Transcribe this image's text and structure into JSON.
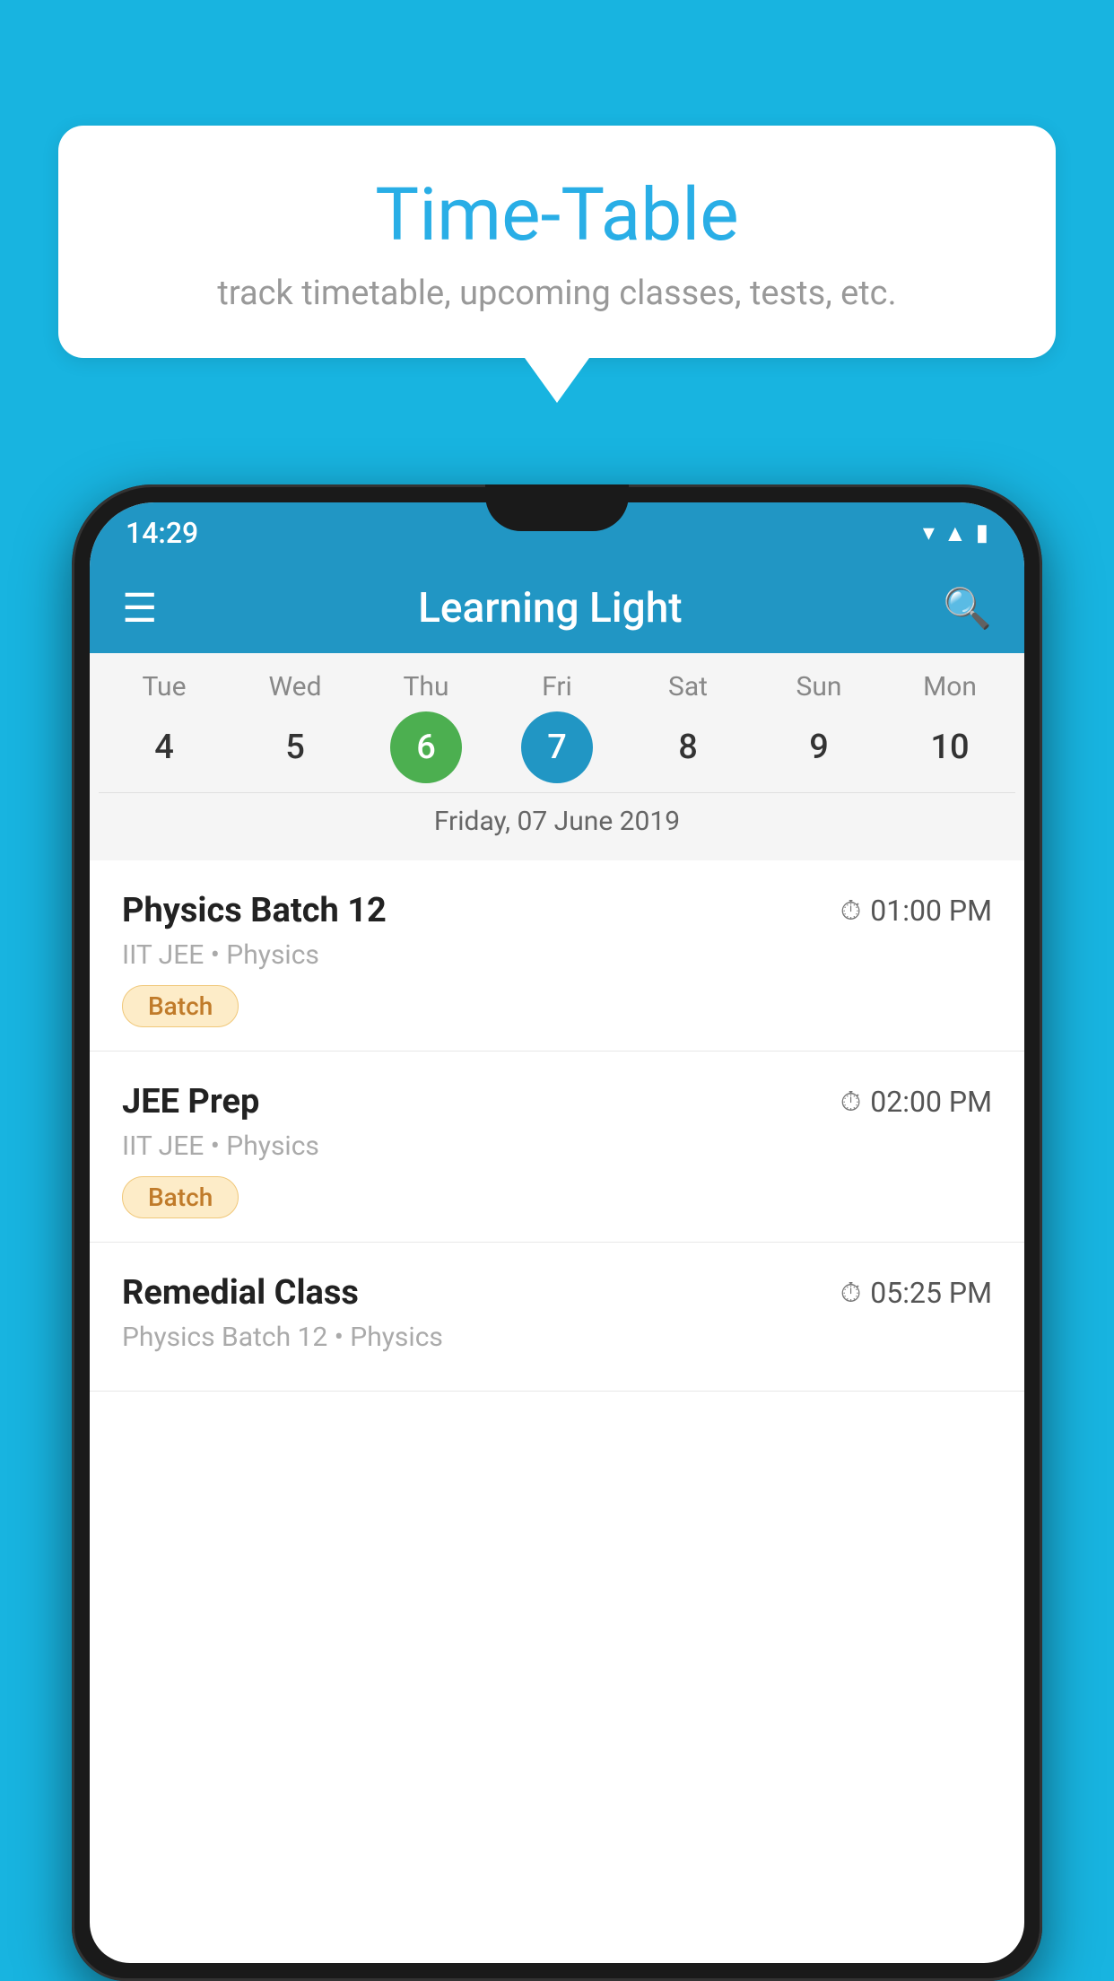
{
  "background_color": "#18b4e0",
  "speech_bubble": {
    "title": "Time-Table",
    "subtitle": "track timetable, upcoming classes, tests, etc."
  },
  "status_bar": {
    "time": "14:29",
    "icons": [
      "wifi",
      "signal",
      "battery"
    ]
  },
  "toolbar": {
    "title": "Learning Light",
    "menu_label": "☰",
    "search_label": "🔍"
  },
  "calendar": {
    "days": [
      {
        "name": "Tue",
        "number": "4",
        "state": "normal"
      },
      {
        "name": "Wed",
        "number": "5",
        "state": "normal"
      },
      {
        "name": "Thu",
        "number": "6",
        "state": "today"
      },
      {
        "name": "Fri",
        "number": "7",
        "state": "selected"
      },
      {
        "name": "Sat",
        "number": "8",
        "state": "normal"
      },
      {
        "name": "Sun",
        "number": "9",
        "state": "normal"
      },
      {
        "name": "Mon",
        "number": "10",
        "state": "normal"
      }
    ],
    "current_date_label": "Friday, 07 June 2019"
  },
  "schedule": {
    "items": [
      {
        "name": "Physics Batch 12",
        "time": "01:00 PM",
        "sub": "IIT JEE • Physics",
        "badge": "Batch"
      },
      {
        "name": "JEE Prep",
        "time": "02:00 PM",
        "sub": "IIT JEE • Physics",
        "badge": "Batch"
      },
      {
        "name": "Remedial Class",
        "time": "05:25 PM",
        "sub": "Physics Batch 12 • Physics",
        "badge": null
      }
    ]
  }
}
